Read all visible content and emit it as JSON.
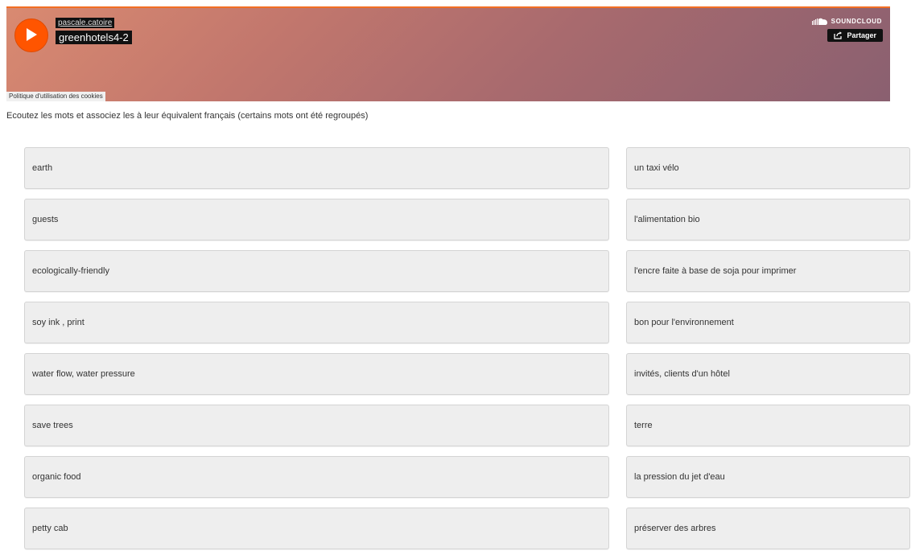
{
  "player": {
    "user": "pascale.catoire",
    "title": "greenhotels4-2",
    "brand": "SOUNDCLOUD",
    "share_label": "Partager",
    "cookie_label": "Politique d'utilisation des cookies",
    "accent_color": "#ff5500"
  },
  "instructions": "Ecoutez les mots et associez les à leur équivalent français (certains mots ont été regroupés)",
  "english_words": [
    "earth",
    "guests",
    "ecologically-friendly",
    "soy ink , print",
    "water flow, water pressure",
    "save trees",
    "organic food",
    "petty cab"
  ],
  "french_words": [
    "un taxi vélo",
    "l'alimentation bio",
    "l'encre faite à base de soja pour imprimer",
    "bon pour l'environnement",
    "invités, clients d'un hôtel",
    "terre",
    "la pression du jet d'eau",
    "préserver des arbres"
  ]
}
